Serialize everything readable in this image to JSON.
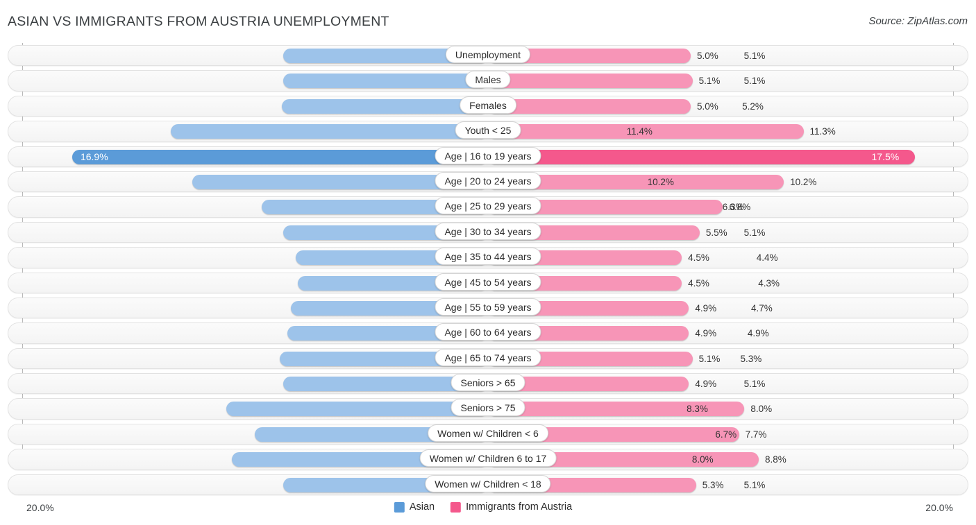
{
  "header": {
    "title": "ASIAN VS IMMIGRANTS FROM AUSTRIA UNEMPLOYMENT",
    "source": "Source: ZipAtlas.com"
  },
  "axis": {
    "min_label": "20.0%",
    "max_label": "20.0%"
  },
  "legend": {
    "items": [
      {
        "label": "Asian",
        "color": "#5b9bd8"
      },
      {
        "label": "Immigrants from Austria",
        "color": "#f4588c"
      }
    ]
  },
  "chart_data": {
    "type": "bar",
    "title": "ASIAN VS IMMIGRANTS FROM AUSTRIA UNEMPLOYMENT",
    "subtitle": "",
    "orientation": "horizontal-diverging",
    "xlabel": "",
    "ylabel": "",
    "xlim": [
      20.0,
      20.0
    ],
    "grid": false,
    "legend_position": "bottom-center",
    "categories": [
      "Unemployment",
      "Males",
      "Females",
      "Youth < 25",
      "Age | 16 to 19 years",
      "Age | 20 to 24 years",
      "Age | 25 to 29 years",
      "Age | 30 to 34 years",
      "Age | 35 to 44 years",
      "Age | 45 to 54 years",
      "Age | 55 to 59 years",
      "Age | 60 to 64 years",
      "Age | 65 to 74 years",
      "Seniors > 65",
      "Seniors > 75",
      "Women w/ Children < 6",
      "Women w/ Children 6 to 17",
      "Women w/ Children < 18"
    ],
    "series": [
      {
        "name": "Asian",
        "color": "#9dc3ea",
        "values": [
          5.1,
          5.1,
          5.2,
          11.4,
          16.9,
          10.2,
          6.3,
          5.1,
          4.4,
          4.3,
          4.7,
          4.9,
          5.3,
          5.1,
          8.3,
          6.7,
          8.0,
          5.1
        ],
        "labels": [
          "5.1%",
          "5.1%",
          "5.2%",
          "11.4%",
          "16.9%",
          "10.2%",
          "6.3%",
          "5.1%",
          "4.4%",
          "4.3%",
          "4.7%",
          "4.9%",
          "5.3%",
          "5.1%",
          "8.3%",
          "6.7%",
          "8.0%",
          "5.1%"
        ]
      },
      {
        "name": "Immigrants from Austria",
        "color": "#f795b7",
        "values": [
          5.0,
          5.1,
          5.0,
          11.3,
          17.5,
          10.2,
          6.8,
          5.5,
          4.5,
          4.5,
          4.9,
          4.9,
          5.1,
          4.9,
          8.0,
          7.7,
          8.8,
          5.3
        ],
        "labels": [
          "5.0%",
          "5.1%",
          "5.0%",
          "11.3%",
          "17.5%",
          "10.2%",
          "6.8%",
          "5.5%",
          "4.5%",
          "4.5%",
          "4.9%",
          "4.9%",
          "5.1%",
          "4.9%",
          "8.0%",
          "7.7%",
          "8.8%",
          "5.3%"
        ]
      }
    ],
    "highlighted_row": 4
  }
}
